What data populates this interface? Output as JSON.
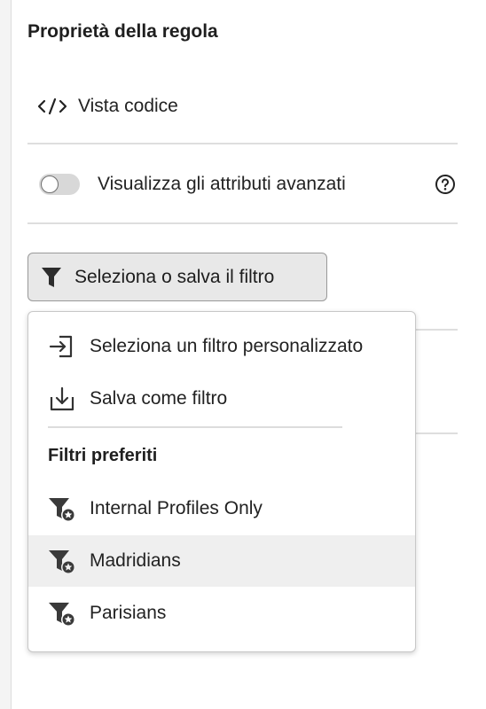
{
  "panel": {
    "title": "Proprietà della regola",
    "code_view_label": "Vista codice",
    "advanced_toggle_label": "Visualizza gli attributi avanzati",
    "advanced_toggle_on": false,
    "filter_button_label": "Seleziona o salva il filtro"
  },
  "menu": {
    "actions": [
      {
        "label": "Seleziona un filtro personalizzato",
        "icon": "import-icon"
      },
      {
        "label": "Salva come filtro",
        "icon": "save-download-icon"
      }
    ],
    "favorites_heading": "Filtri preferiti",
    "favorites": [
      {
        "label": "Internal Profiles Only",
        "icon": "favorite-filter-icon",
        "highlighted": false
      },
      {
        "label": "Madridians",
        "icon": "favorite-filter-icon",
        "highlighted": true
      },
      {
        "label": "Parisians",
        "icon": "favorite-filter-icon",
        "highlighted": false
      }
    ]
  },
  "colors": {
    "button_background": "#e8e8e8",
    "hover_row": "#efefef",
    "icon_dark": "#3a3a3a"
  }
}
